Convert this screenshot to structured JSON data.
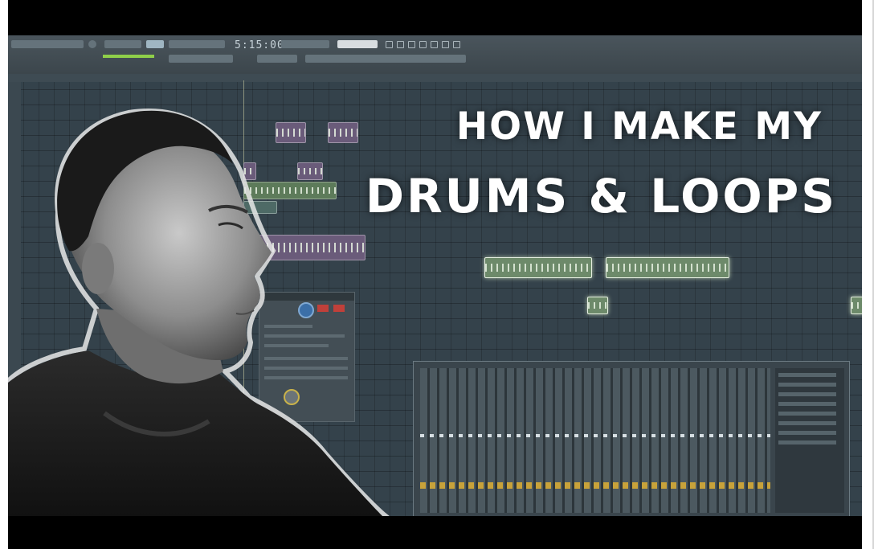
{
  "thumbnail": {
    "title_line1": "HOW I MAKE MY",
    "title_line2": "DRUMS & LOOPS",
    "daw_time_display": "5:15:00"
  },
  "colors": {
    "letterbox": "#000000",
    "playlist_bg": "#34424b",
    "title_text": "#ffffff",
    "clip_highlight": "#e6efe1"
  }
}
